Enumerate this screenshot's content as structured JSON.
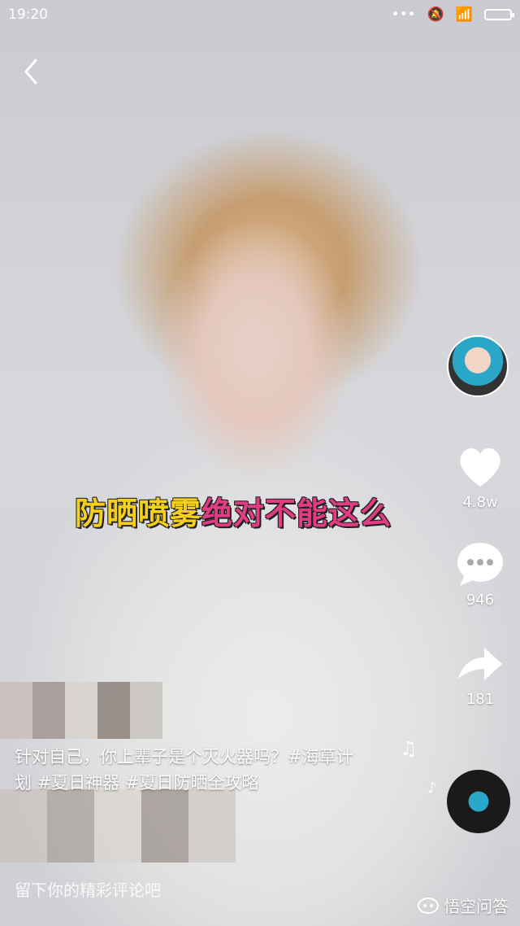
{
  "status": {
    "time": "19:20"
  },
  "video": {
    "caption_part1": "防晒喷雾",
    "caption_part2": "绝对不能这么"
  },
  "actions": {
    "likes": "4.8w",
    "comments": "946",
    "shares": "181"
  },
  "description": {
    "line1": "针对自己，你上辈子是个灭火器吗？#海草计",
    "line2": "划 #夏日神器 #夏日防晒全攻略"
  },
  "comment_input": {
    "placeholder": "留下你的精彩评论吧"
  },
  "watermark": {
    "text": "悟空问答"
  }
}
